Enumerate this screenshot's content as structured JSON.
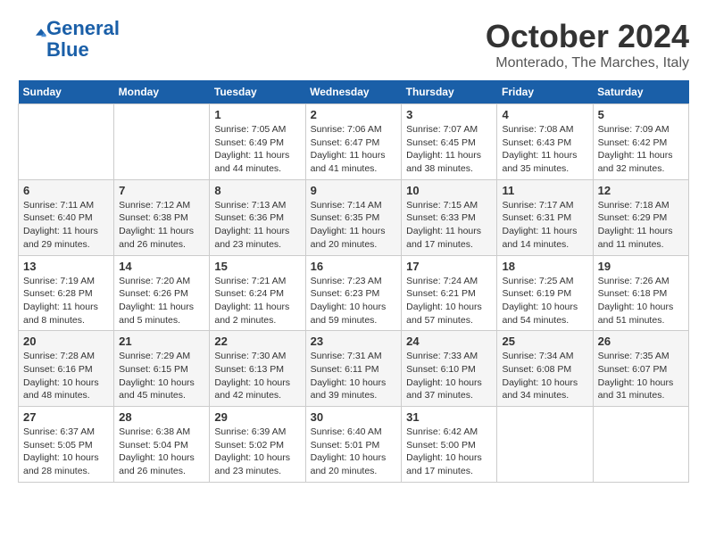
{
  "logo": {
    "line1": "General",
    "line2": "Blue"
  },
  "title": "October 2024",
  "location": "Monterado, The Marches, Italy",
  "headers": [
    "Sunday",
    "Monday",
    "Tuesday",
    "Wednesday",
    "Thursday",
    "Friday",
    "Saturday"
  ],
  "weeks": [
    [
      {
        "day": "",
        "info": ""
      },
      {
        "day": "",
        "info": ""
      },
      {
        "day": "1",
        "info": "Sunrise: 7:05 AM\nSunset: 6:49 PM\nDaylight: 11 hours and 44 minutes."
      },
      {
        "day": "2",
        "info": "Sunrise: 7:06 AM\nSunset: 6:47 PM\nDaylight: 11 hours and 41 minutes."
      },
      {
        "day": "3",
        "info": "Sunrise: 7:07 AM\nSunset: 6:45 PM\nDaylight: 11 hours and 38 minutes."
      },
      {
        "day": "4",
        "info": "Sunrise: 7:08 AM\nSunset: 6:43 PM\nDaylight: 11 hours and 35 minutes."
      },
      {
        "day": "5",
        "info": "Sunrise: 7:09 AM\nSunset: 6:42 PM\nDaylight: 11 hours and 32 minutes."
      }
    ],
    [
      {
        "day": "6",
        "info": "Sunrise: 7:11 AM\nSunset: 6:40 PM\nDaylight: 11 hours and 29 minutes."
      },
      {
        "day": "7",
        "info": "Sunrise: 7:12 AM\nSunset: 6:38 PM\nDaylight: 11 hours and 26 minutes."
      },
      {
        "day": "8",
        "info": "Sunrise: 7:13 AM\nSunset: 6:36 PM\nDaylight: 11 hours and 23 minutes."
      },
      {
        "day": "9",
        "info": "Sunrise: 7:14 AM\nSunset: 6:35 PM\nDaylight: 11 hours and 20 minutes."
      },
      {
        "day": "10",
        "info": "Sunrise: 7:15 AM\nSunset: 6:33 PM\nDaylight: 11 hours and 17 minutes."
      },
      {
        "day": "11",
        "info": "Sunrise: 7:17 AM\nSunset: 6:31 PM\nDaylight: 11 hours and 14 minutes."
      },
      {
        "day": "12",
        "info": "Sunrise: 7:18 AM\nSunset: 6:29 PM\nDaylight: 11 hours and 11 minutes."
      }
    ],
    [
      {
        "day": "13",
        "info": "Sunrise: 7:19 AM\nSunset: 6:28 PM\nDaylight: 11 hours and 8 minutes."
      },
      {
        "day": "14",
        "info": "Sunrise: 7:20 AM\nSunset: 6:26 PM\nDaylight: 11 hours and 5 minutes."
      },
      {
        "day": "15",
        "info": "Sunrise: 7:21 AM\nSunset: 6:24 PM\nDaylight: 11 hours and 2 minutes."
      },
      {
        "day": "16",
        "info": "Sunrise: 7:23 AM\nSunset: 6:23 PM\nDaylight: 10 hours and 59 minutes."
      },
      {
        "day": "17",
        "info": "Sunrise: 7:24 AM\nSunset: 6:21 PM\nDaylight: 10 hours and 57 minutes."
      },
      {
        "day": "18",
        "info": "Sunrise: 7:25 AM\nSunset: 6:19 PM\nDaylight: 10 hours and 54 minutes."
      },
      {
        "day": "19",
        "info": "Sunrise: 7:26 AM\nSunset: 6:18 PM\nDaylight: 10 hours and 51 minutes."
      }
    ],
    [
      {
        "day": "20",
        "info": "Sunrise: 7:28 AM\nSunset: 6:16 PM\nDaylight: 10 hours and 48 minutes."
      },
      {
        "day": "21",
        "info": "Sunrise: 7:29 AM\nSunset: 6:15 PM\nDaylight: 10 hours and 45 minutes."
      },
      {
        "day": "22",
        "info": "Sunrise: 7:30 AM\nSunset: 6:13 PM\nDaylight: 10 hours and 42 minutes."
      },
      {
        "day": "23",
        "info": "Sunrise: 7:31 AM\nSunset: 6:11 PM\nDaylight: 10 hours and 39 minutes."
      },
      {
        "day": "24",
        "info": "Sunrise: 7:33 AM\nSunset: 6:10 PM\nDaylight: 10 hours and 37 minutes."
      },
      {
        "day": "25",
        "info": "Sunrise: 7:34 AM\nSunset: 6:08 PM\nDaylight: 10 hours and 34 minutes."
      },
      {
        "day": "26",
        "info": "Sunrise: 7:35 AM\nSunset: 6:07 PM\nDaylight: 10 hours and 31 minutes."
      }
    ],
    [
      {
        "day": "27",
        "info": "Sunrise: 6:37 AM\nSunset: 5:05 PM\nDaylight: 10 hours and 28 minutes."
      },
      {
        "day": "28",
        "info": "Sunrise: 6:38 AM\nSunset: 5:04 PM\nDaylight: 10 hours and 26 minutes."
      },
      {
        "day": "29",
        "info": "Sunrise: 6:39 AM\nSunset: 5:02 PM\nDaylight: 10 hours and 23 minutes."
      },
      {
        "day": "30",
        "info": "Sunrise: 6:40 AM\nSunset: 5:01 PM\nDaylight: 10 hours and 20 minutes."
      },
      {
        "day": "31",
        "info": "Sunrise: 6:42 AM\nSunset: 5:00 PM\nDaylight: 10 hours and 17 minutes."
      },
      {
        "day": "",
        "info": ""
      },
      {
        "day": "",
        "info": ""
      }
    ]
  ]
}
